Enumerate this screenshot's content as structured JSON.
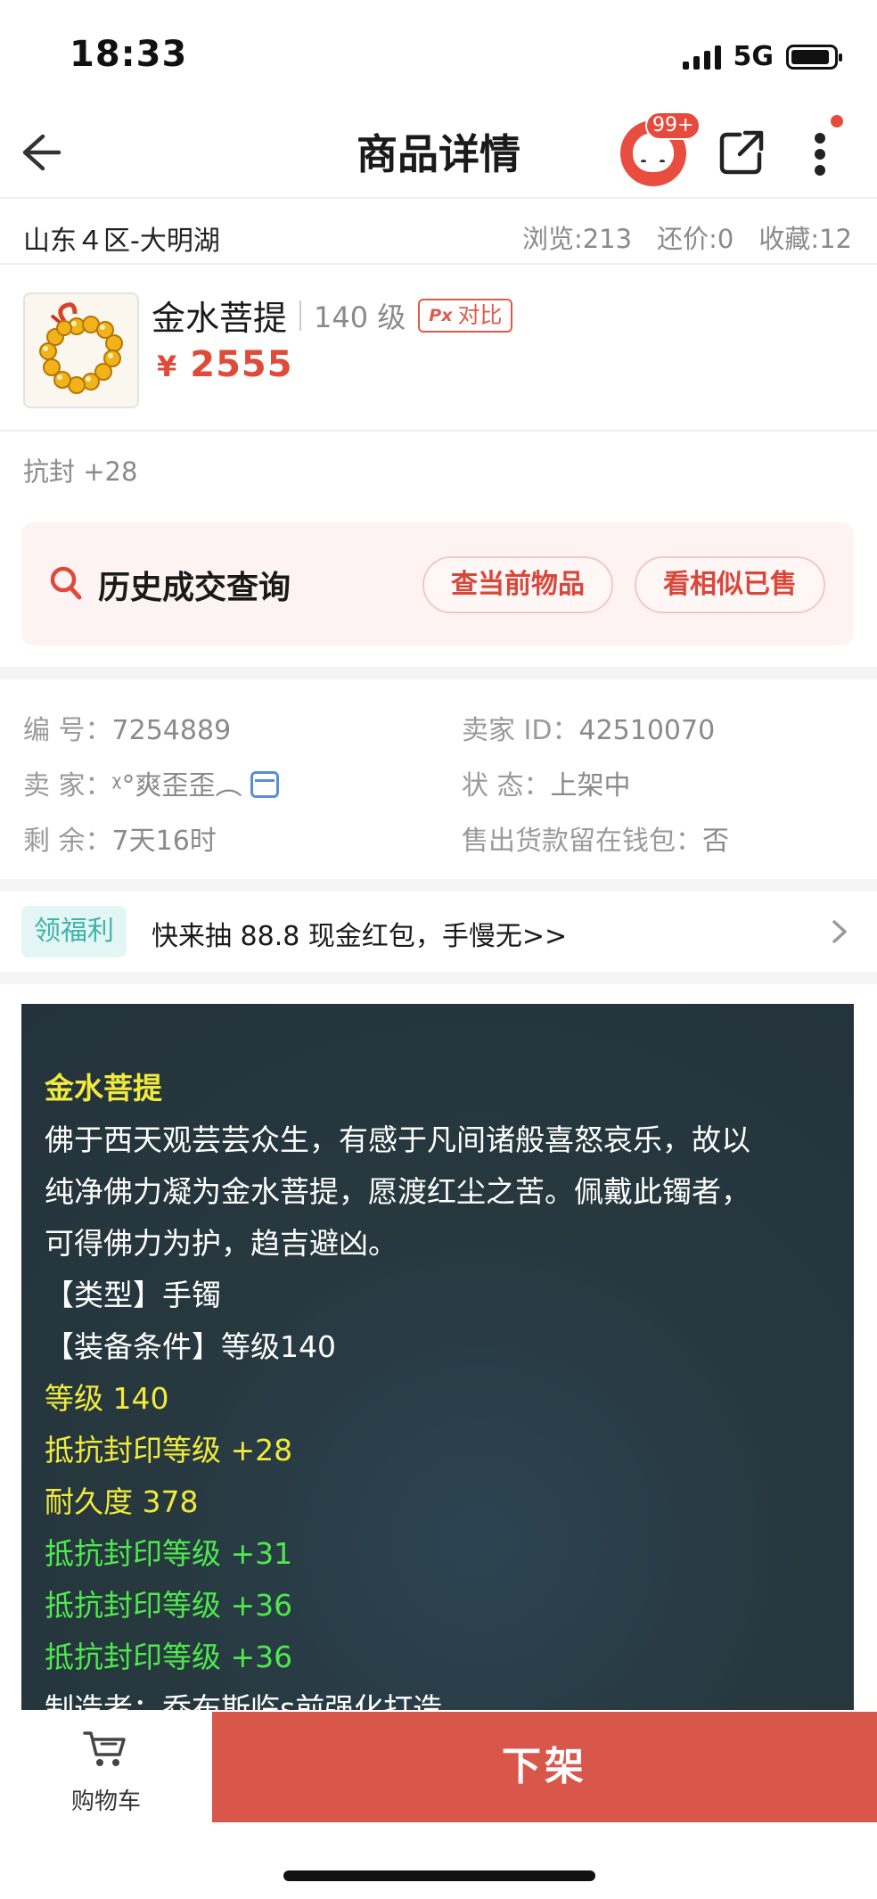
{
  "status_bar": {
    "time": "18:33",
    "network": "5G"
  },
  "nav": {
    "title": "商品详情",
    "badge": "99+"
  },
  "location": {
    "server": "山东４区-大明湖"
  },
  "stats": {
    "views": "浏览:213",
    "bargains": "还价:0",
    "favorites": "收藏:12"
  },
  "product": {
    "name": "金水菩提",
    "level": "140 级",
    "compare_label": "对比",
    "compare_icon_text": "Px",
    "currency": "¥",
    "price": "2555"
  },
  "attribute_summary": "抗封 +28",
  "history": {
    "title": "历史成交查询",
    "current_item_button": "查当前物品",
    "similar_sold_button": "看相似已售"
  },
  "info": {
    "id_label": "编 号：",
    "id_value": "7254889",
    "seller_id_label": "卖家 ID：",
    "seller_id_value": "42510070",
    "seller_label": "卖 家：",
    "seller_value": "ᵡ°爽歪歪︵",
    "status_label": "状 态：",
    "status_value": "上架中",
    "remaining_label": "剩 余：",
    "remaining_value": "7天16时",
    "wallet_label": "售出货款留在钱包：",
    "wallet_value": "否"
  },
  "welfare": {
    "tag": "领福利",
    "text": "快来抽 88.8 现金红包，手慢无>>"
  },
  "description": {
    "title": "金水菩提",
    "lore_1": "佛于西天观芸芸众生，有感于凡间诸般喜怒哀乐，故以",
    "lore_2": "纯净佛力凝为金水菩提，愿渡红尘之苦。佩戴此镯者，",
    "lore_3": "可得佛力为护，趋吉避凶。",
    "type": "【类型】手镯",
    "requirement": "【装备条件】等级140",
    "level": "等级 140",
    "base_attr": "抵抗封印等级 +28",
    "durability": "耐久度 378",
    "bonus_1": "抵抗封印等级 +31",
    "bonus_2": "抵抗封印等级 +36",
    "bonus_3": "抵抗封印等级 +36",
    "maker": "制造者：乔布斯临s前强化打造"
  },
  "bottom": {
    "cart_label": "购物车",
    "offshelf_label": "下架"
  },
  "colors": {
    "accent_red": "#d9564b",
    "price_red": "#e04a3a",
    "panel_bg": "#26363f",
    "yellow_text": "#f0ea3c",
    "green_text": "#4ee84e",
    "teal_tag": "#3fb5a9"
  }
}
